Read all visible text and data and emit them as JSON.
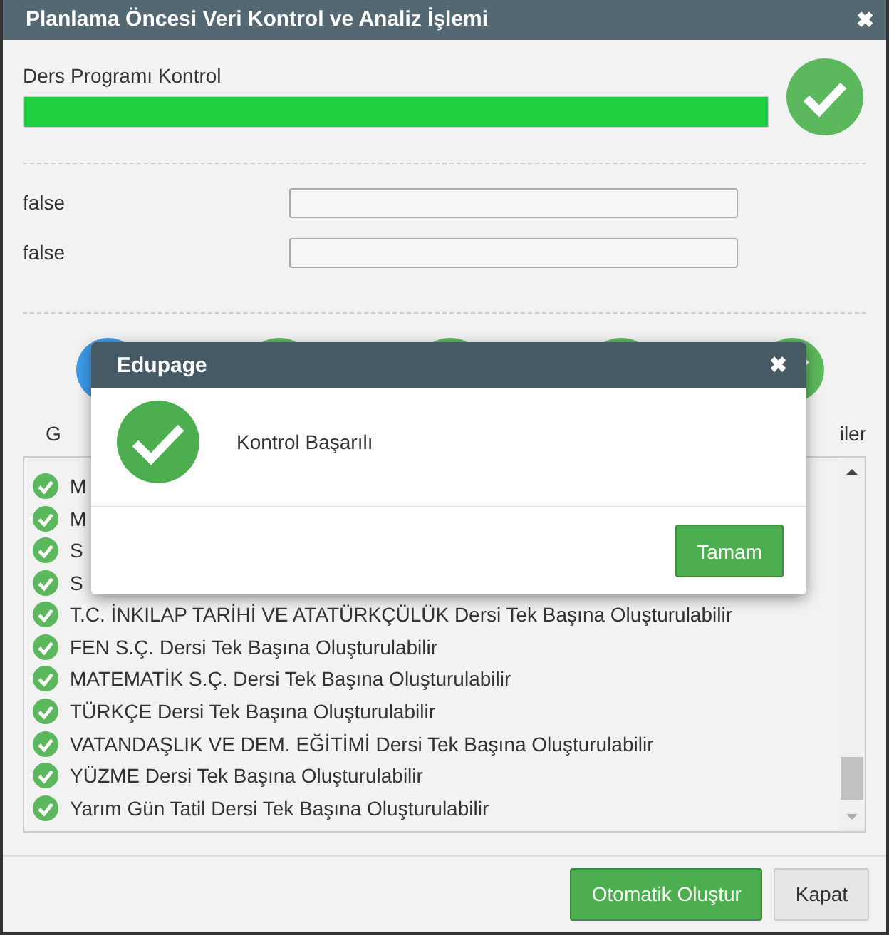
{
  "window": {
    "title": "Planlama Öncesi Veri Kontrol ve Analiz İşlemi",
    "close": "✖"
  },
  "progress": {
    "label": "Ders Programı Kontrol",
    "level": 1,
    "done": true
  },
  "fields": [
    {
      "label": "false"
    },
    {
      "label": "false"
    }
  ],
  "steps": [
    {
      "kind": "info",
      "label": "G"
    },
    {
      "kind": "done"
    },
    {
      "kind": "done"
    },
    {
      "kind": "done"
    },
    {
      "kind": "done",
      "label": "iler"
    }
  ],
  "checks": [
    {
      "text": "M"
    },
    {
      "text": "M"
    },
    {
      "text": "S"
    },
    {
      "text": "S"
    },
    {
      "text": "T.C. İNKILAP TARİHİ VE ATATÜRKÇÜLÜK Dersi Tek Başına Oluşturulabilir"
    },
    {
      "text": "FEN S.Ç. Dersi Tek Başına Oluşturulabilir"
    },
    {
      "text": "MATEMATİK S.Ç. Dersi Tek Başına Oluşturulabilir"
    },
    {
      "text": "TÜRKÇE Dersi Tek Başına Oluşturulabilir"
    },
    {
      "text": "VATANDAŞLIK VE DEM. EĞİTİMİ Dersi Tek Başına Oluşturulabilir"
    },
    {
      "text": "YÜZME Dersi Tek Başına Oluşturulabilir"
    },
    {
      "text": "Yarım Gün Tatil Dersi Tek Başına Oluşturulabilir"
    }
  ],
  "buttons": [
    {
      "label": "Otomatik Oluştur",
      "kind": "primary"
    },
    {
      "label": "Kapat",
      "kind": "secondary"
    }
  ],
  "modal": {
    "title": "Edupage",
    "close": "✖",
    "message": "Kontrol Başarılı",
    "button": "Tamam"
  }
}
